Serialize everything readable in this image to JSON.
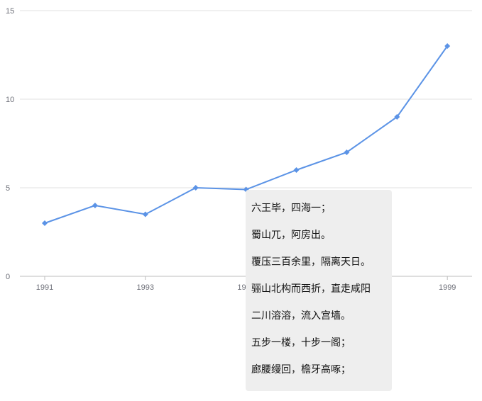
{
  "chart_data": {
    "type": "line",
    "title": "",
    "xlabel": "",
    "ylabel": "",
    "x": [
      "1991",
      "1992",
      "1993",
      "1994",
      "1995",
      "1996",
      "1997",
      "1998",
      "1999"
    ],
    "x_tick_labels": [
      "1991",
      "1993",
      "1995",
      "1997",
      "1999"
    ],
    "y_tick_labels": [
      "0",
      "5",
      "10",
      "15"
    ],
    "ylim": [
      0,
      15
    ],
    "grid": true,
    "series": [
      {
        "values": [
          3,
          4,
          3.5,
          5,
          4.9,
          6,
          7,
          9,
          13
        ],
        "color": "#5b93e6",
        "marker": "diamond"
      }
    ]
  },
  "tooltip": {
    "lines": [
      "六王毕，四海一；",
      "蜀山兀，阿房出。",
      "覆压三百余里，隔离天日。",
      "骊山北构而西折，直走咸阳",
      "二川溶溶，流入宫墙。",
      "五步一楼，十步一阁；",
      "廊腰缦回，檐牙高啄；"
    ]
  }
}
